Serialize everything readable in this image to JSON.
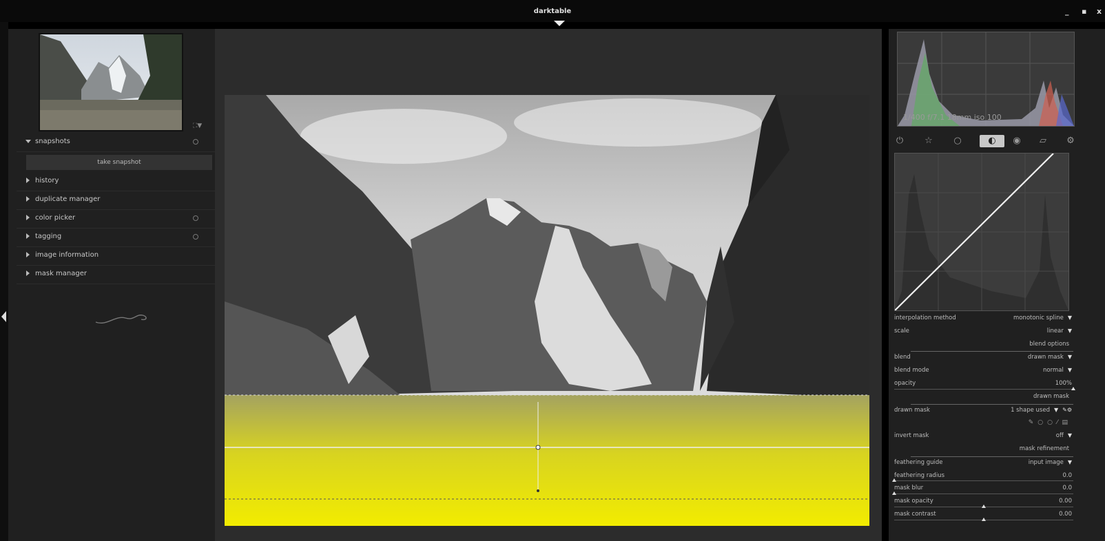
{
  "window": {
    "title": "darktable",
    "minimize": "_",
    "maximize": "▪",
    "close": "x"
  },
  "left": {
    "thumb_ctl": "⛶▼",
    "modules": [
      {
        "label": "snapshots",
        "expanded": true,
        "reset": true
      },
      {
        "label": "history",
        "expanded": false,
        "reset": false
      },
      {
        "label": "duplicate manager",
        "expanded": false,
        "reset": false
      },
      {
        "label": "color picker",
        "expanded": false,
        "reset": true
      },
      {
        "label": "tagging",
        "expanded": false,
        "reset": true
      },
      {
        "label": "image information",
        "expanded": false,
        "reset": false
      },
      {
        "label": "mask manager",
        "expanded": false,
        "reset": false
      }
    ],
    "snapshot_button": "take snapshot"
  },
  "histogram": {
    "exif": "1/400 f/7.1 18mm iso 100"
  },
  "module_tabs": [
    {
      "icon": "power-icon",
      "glyph": "⏻"
    },
    {
      "icon": "star-icon",
      "glyph": "☆"
    },
    {
      "icon": "circle-icon",
      "glyph": "○"
    },
    {
      "icon": "tone-icon",
      "glyph": "◐",
      "active": true
    },
    {
      "icon": "color-icon",
      "glyph": "◉"
    },
    {
      "icon": "shape-icon",
      "glyph": "▱"
    },
    {
      "icon": "gear-icon",
      "glyph": "⚙"
    }
  ],
  "params": {
    "interpolation_method": {
      "label": "interpolation method",
      "value": "monotonic spline"
    },
    "scale": {
      "label": "scale",
      "value": "linear"
    },
    "blend_options_section": "blend options",
    "blend": {
      "label": "blend",
      "value": "drawn mask"
    },
    "blend_mode": {
      "label": "blend mode",
      "value": "normal"
    },
    "opacity": {
      "label": "opacity",
      "value": "100%",
      "level": 1.0
    },
    "drawn_mask_section": "drawn mask",
    "drawn_mask": {
      "label": "drawn mask",
      "value": "1 shape used"
    },
    "invert_mask": {
      "label": "invert mask",
      "value": "off"
    },
    "mask_refinement_section": "mask refinement",
    "feathering_guide": {
      "label": "feathering guide",
      "value": "input image"
    },
    "feathering_radius": {
      "label": "feathering radius",
      "value": "0.0",
      "level": 0.0
    },
    "mask_blur": {
      "label": "mask blur",
      "value": "0.0",
      "level": 0.0
    },
    "mask_opacity": {
      "label": "mask opacity",
      "value": "0.00",
      "level": 0.5
    },
    "mask_contrast": {
      "label": "mask contrast",
      "value": "0.00",
      "level": 0.5
    }
  },
  "colors": {
    "mask": "#f2ec00",
    "panel": "#202020",
    "center": "#2c2c2c"
  }
}
